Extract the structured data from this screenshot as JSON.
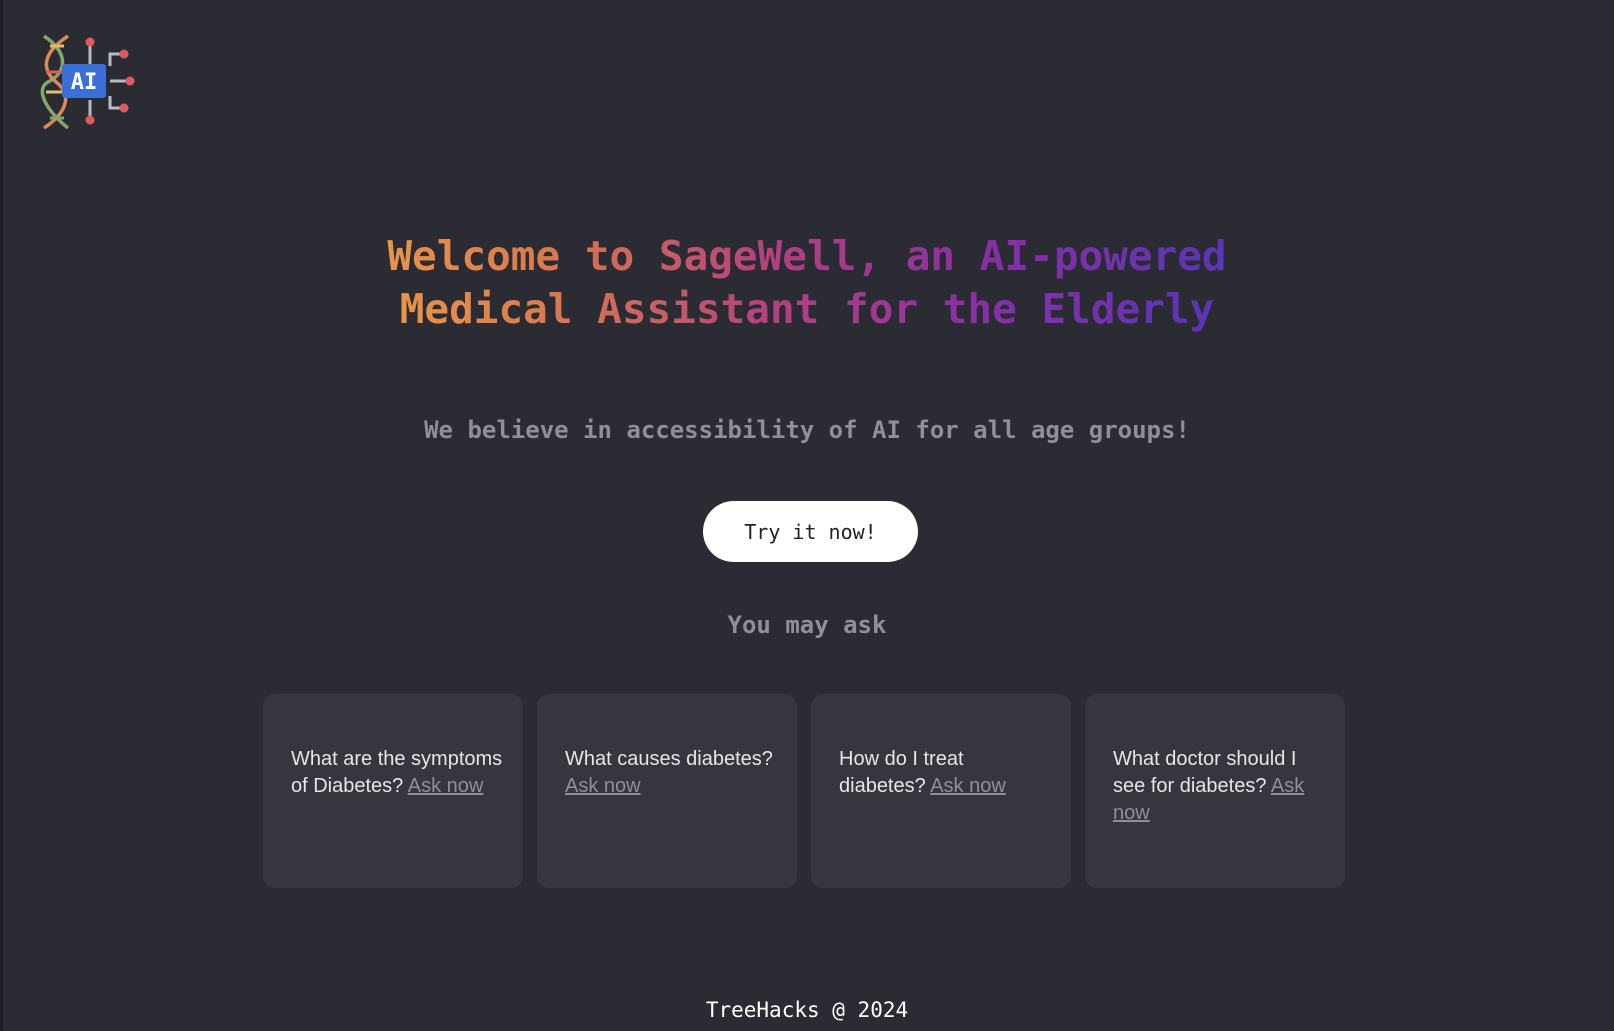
{
  "logo": {
    "text": "AI",
    "icon": "dna-ai-logo-icon"
  },
  "hero": {
    "headline_line1": "Welcome to SageWell, an AI-powered",
    "headline_line2": "Medical Assistant for the Elderly",
    "tagline": "We believe in accessibility of AI for all age groups!",
    "cta_label": "Try it now!"
  },
  "suggestions": {
    "heading": "You may ask",
    "link_label": "Ask now",
    "items": [
      {
        "question": "What are the symptoms of Diabetes?"
      },
      {
        "question": "What causes diabetes?"
      },
      {
        "question": "How do I treat diabetes?"
      },
      {
        "question": "What doctor should I see for diabetes?"
      }
    ]
  },
  "footer": {
    "text": "TreeHacks @ 2024"
  },
  "colors": {
    "background": "#2b2c33",
    "card": "#36373e",
    "gradient_start": "#e8944a",
    "gradient_mid": "#b5427e",
    "gradient_end": "#5b34b5",
    "logo_blue": "#3b6fd6"
  }
}
